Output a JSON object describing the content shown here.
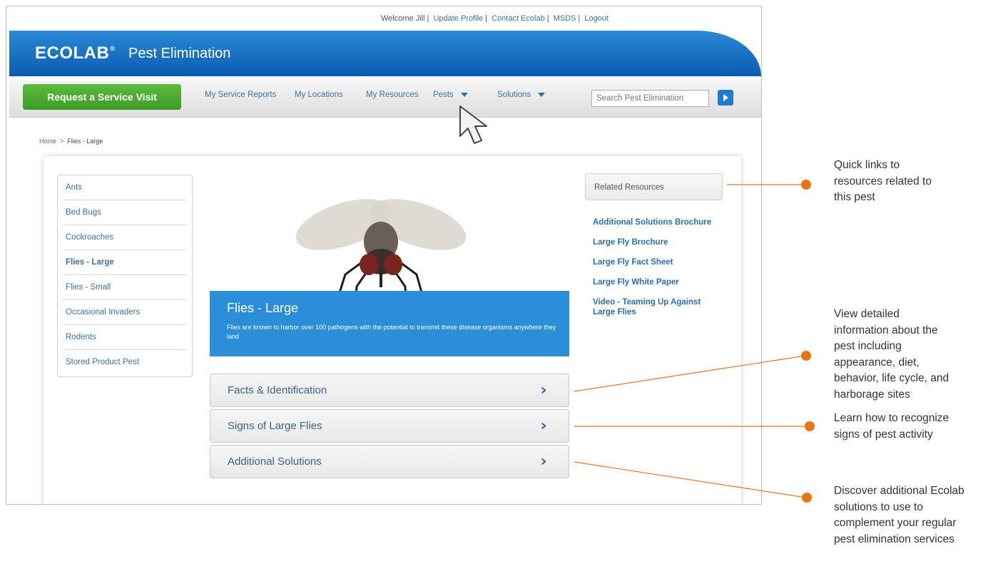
{
  "top_links": {
    "welcome": "Welcome Jill",
    "update_profile": "Update Profile",
    "contact": "Contact Ecolab",
    "msds": "MSDS",
    "logout": "Logout"
  },
  "brand": {
    "logo": "ECOLAB",
    "logo_mark": "®",
    "name": "Pest Elimination",
    "color": "#1a6fc4"
  },
  "nav": {
    "request_button": "Request a Service Visit",
    "request_color": "#4aab2e",
    "items": [
      "My Service Reports",
      "My Locations",
      "My Resources",
      "Pests",
      "Solutions"
    ],
    "search_placeholder": "Search Pest Elimination"
  },
  "breadcrumb": {
    "home": "Home",
    "separator": ">",
    "current": "Flies - Large"
  },
  "pest_list": [
    "Ants",
    "Bed Bugs",
    "Cockroaches",
    "Flies - Large",
    "Flies - Small",
    "Occasional Invaders",
    "Rodents",
    "Stored Product Pest"
  ],
  "hero": {
    "title": "Flies - Large",
    "description": "Flies are known to harbor over 100 pathogens with the potential to transmit these disease organisms anywhere they land"
  },
  "sections": [
    "Facts & Identification",
    "Signs of Large Flies",
    "Additional Solutions"
  ],
  "related": {
    "title": "Related Resources",
    "links": [
      "Additional Solutions Brochure",
      "Large Fly Brochure",
      "Large Fly Fact Sheet",
      "Large Fly White Paper",
      "Video - Teaming Up Against Large Flies"
    ]
  },
  "callouts": [
    "Quick links to resources related to this pest",
    "View detailed information about the pest including appearance, diet, behavior, life cycle, and harborage sites",
    "Learn how to recognize signs of pest activity",
    "Discover additional Ecolab solutions to use to complement your regular pest elimination services"
  ],
  "callout_color": "#e8750f"
}
